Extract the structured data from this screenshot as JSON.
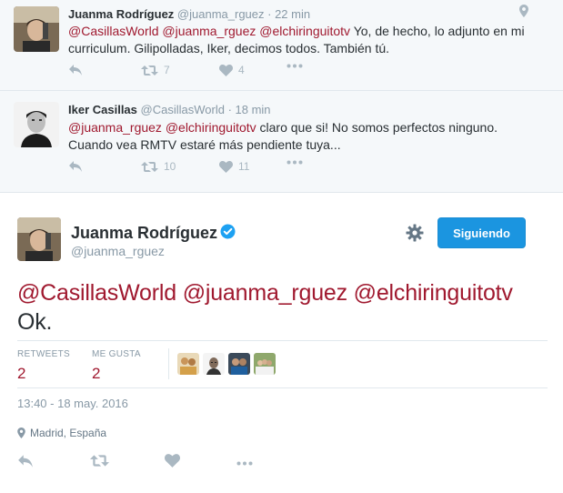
{
  "replies": [
    {
      "name": "Juanma Rodríguez",
      "handle": "@juanma_rguez",
      "time": "· 22 min",
      "mentions": [
        "@CasillasWorld",
        "@juanma_rguez",
        "@elchiringuitotv"
      ],
      "text": "Yo, de hecho, lo adjunto en mi curriculum. Gilipolladas, Iker, decimos todos. También tú.",
      "retweets": "7",
      "likes": "4"
    },
    {
      "name": "Iker Casillas",
      "handle": "@CasillasWorld",
      "time": "· 18 min",
      "mentions": [
        "@juanma_rguez",
        "@elchiringuitotv"
      ],
      "text": "claro que si! No somos perfectos ninguno. Cuando vea RMTV estaré más pendiente tuya...",
      "retweets": "10",
      "likes": "11"
    }
  ],
  "main": {
    "name": "Juanma Rodríguez",
    "handle": "@juanma_rguez",
    "follow_label": "Siguiendo",
    "mentions": [
      "@CasillasWorld",
      "@juanma_rguez",
      "@elchiringuitotv"
    ],
    "text": "Ok.",
    "retweets_label": "RETWEETS",
    "retweets_value": "2",
    "likes_label": "ME GUSTA",
    "likes_value": "2",
    "date": "13:40 - 18 may. 2016",
    "location": "Madrid, España"
  },
  "colors": {
    "mention": "#a0192f",
    "accent": "#1b95e0",
    "muted": "#8899a6",
    "reply_bg": "#f5f8fa"
  },
  "icons": [
    "reply-icon",
    "retweet-icon",
    "like-icon",
    "more-icon",
    "location-pin-icon",
    "gear-icon",
    "verified-icon"
  ]
}
